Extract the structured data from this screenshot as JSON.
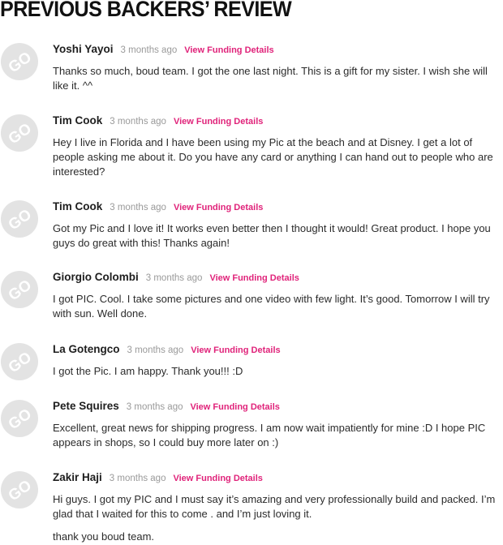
{
  "section": {
    "title": "PREVIOUS BACKERS’ REVIEW"
  },
  "reviews": [
    {
      "name": "Yoshi Yayoi",
      "time": "3 months ago",
      "link": "View Funding Details",
      "text": "Thanks so much, boud team. I got the one last night. This is a gift for my sister. I wish she will like it. ^^"
    },
    {
      "name": "Tim Cook",
      "time": "3 months ago",
      "link": "View Funding Details",
      "text": "Hey I live in Florida and I have been using my Pic at the beach and at Disney. I get a lot of people asking me about it. Do you have any card or anything I can hand out to people who are interested?"
    },
    {
      "name": "Tim Cook",
      "time": "3 months ago",
      "link": "View Funding Details",
      "text": "Got my Pic and I love it! It works even better then I thought it would! Great product. I hope you guys do great with this! Thanks again!"
    },
    {
      "name": "Giorgio Colombi",
      "time": "3 months ago",
      "link": "View Funding Details",
      "text": "I got PIC. Cool. I take some pictures and one video with few light. It’s good. Tomorrow I will try with sun. Well done."
    },
    {
      "name": "La Gotengco",
      "time": "3 months ago",
      "link": "View Funding Details",
      "text": "I got the Pic. I am happy. Thank you!!! :D"
    },
    {
      "name": "Pete Squires",
      "time": "3 months ago",
      "link": "View Funding Details",
      "text": "Excellent, great news for shipping progress. I am now wait impatiently for mine :D I hope PIC appears in shops, so I could buy more later on :)"
    },
    {
      "name": "Zakir Haji",
      "time": "3 months ago",
      "link": "View Funding Details",
      "text": "Hi guys. I got my PIC and I must say it’s amazing and very professionally build and packed. I’m glad that I waited for this to come . and I’m just loving it.",
      "text_extra": "thank you boud team."
    }
  ],
  "avatar_placeholder": {
    "icon": "go-avatar-icon",
    "label": "GO",
    "background": "#e3e3e3",
    "foreground": "#ffffff"
  },
  "colors": {
    "link": "#e0237a",
    "timestamp": "#9a9a9a",
    "name": "#1e1e1e",
    "body": "#2b2b2b"
  }
}
